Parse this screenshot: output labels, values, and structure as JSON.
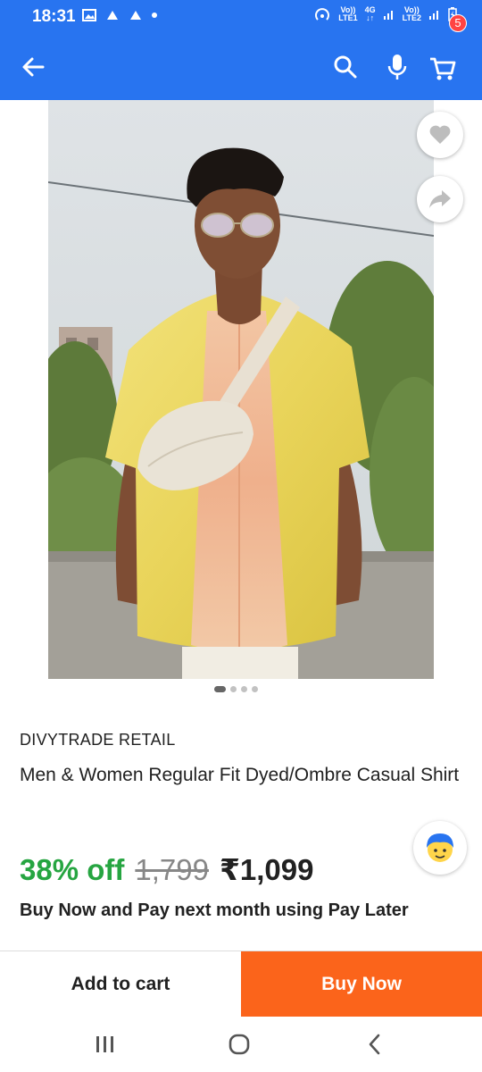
{
  "status_bar": {
    "time": "18:31",
    "sim1_top": "Vo))",
    "sim1_bottom": "LTE1",
    "net_type": "4G",
    "sim2_top": "Vo))",
    "sim2_bottom": "LTE2"
  },
  "app_bar": {
    "cart_count": "5"
  },
  "product": {
    "seller": "DIVYTRADE RETAIL",
    "title": "Men & Women Regular Fit Dyed/Ombre Casual Shirt",
    "discount": "38% off",
    "mrp": "1,799",
    "price": "₹1,099",
    "pay_later": "Buy Now and Pay next month using Pay Later"
  },
  "carousel": {
    "count": 4,
    "active": 0
  },
  "actions": {
    "add_to_cart": "Add to cart",
    "buy_now": "Buy Now"
  },
  "colors": {
    "brand_blue": "#2874f0",
    "discount_green": "#26a541",
    "buy_orange": "#fb641b",
    "badge_red": "#ff4343"
  }
}
